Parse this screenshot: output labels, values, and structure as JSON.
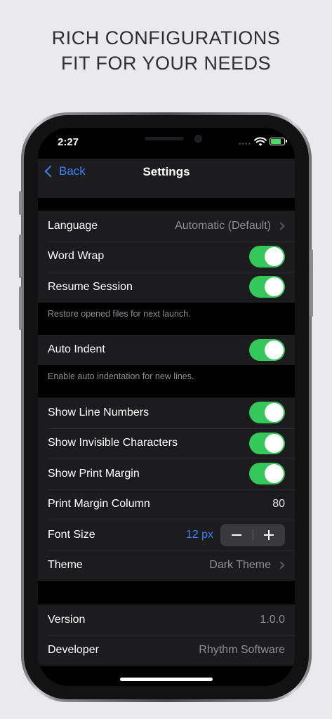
{
  "headline": {
    "line1": "RICH CONFIGURATIONS",
    "line2": "FIT FOR YOUR NEEDS"
  },
  "status_bar": {
    "time": "2:27",
    "icons": [
      "cellular-dots-icon",
      "wifi-icon",
      "battery-charging-icon"
    ],
    "battery_level": 0.75
  },
  "navbar": {
    "back_label": "Back",
    "title": "Settings"
  },
  "section1": {
    "language_label": "Language",
    "language_value": "Automatic (Default)",
    "word_wrap_label": "Word Wrap",
    "word_wrap_on": true,
    "resume_session_label": "Resume Session",
    "resume_session_on": true,
    "footer": "Restore opened files for next launch."
  },
  "section2": {
    "auto_indent_label": "Auto Indent",
    "auto_indent_on": true,
    "footer": "Enable auto indentation for new lines."
  },
  "section3": {
    "show_line_numbers_label": "Show Line Numbers",
    "show_line_numbers_on": true,
    "show_invisible_label": "Show Invisible Characters",
    "show_invisible_on": true,
    "show_print_margin_label": "Show Print Margin",
    "show_print_margin_on": true,
    "print_margin_column_label": "Print Margin Column",
    "print_margin_column_value": "80",
    "font_size_label": "Font Size",
    "font_size_value": "12 px",
    "theme_label": "Theme",
    "theme_value": "Dark Theme"
  },
  "section4": {
    "version_label": "Version",
    "version_value": "1.0.0",
    "developer_label": "Developer",
    "developer_value": "Rhythm Software"
  },
  "colors": {
    "accent": "#3a82f7",
    "toggle_on": "#34c759",
    "background": "#000000",
    "cell": "#1c1c1e"
  }
}
